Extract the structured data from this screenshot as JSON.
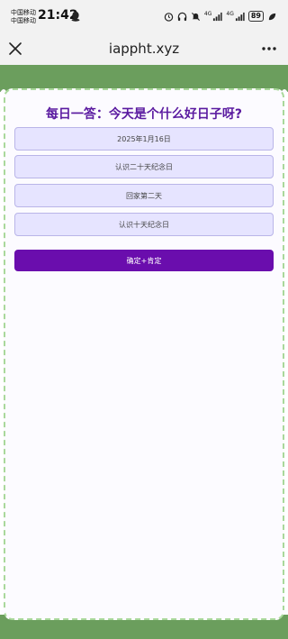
{
  "status_bar": {
    "carrier_1": "中国移动",
    "carrier_2": "中国移动",
    "time": "21:42",
    "network_1": "4G",
    "network_2": "4G",
    "battery": "89"
  },
  "browser": {
    "url": "iappht.xyz"
  },
  "page": {
    "title": "每日一答：今天是个什么好日子呀?",
    "options": [
      "2025年1月16日",
      "认识二十天纪念日",
      "回家第二天",
      "认识十天纪念日"
    ],
    "confirm_label": "确定+肯定"
  },
  "colors": {
    "accent": "#6a0dad",
    "option_bg": "#e6e4ff",
    "header_green": "#6b9e5d",
    "border_green": "#a9d89b"
  }
}
